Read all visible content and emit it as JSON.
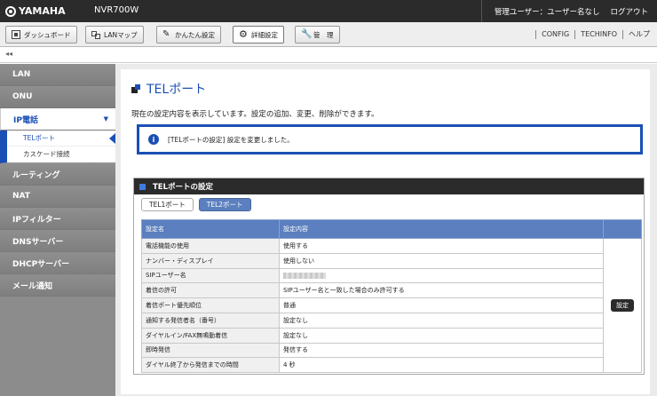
{
  "brand": {
    "logo_text": "YAMAHA",
    "model": "NVR700W"
  },
  "header": {
    "user_label": "管理ユーザー：ユーザー名なし",
    "logout": "ログアウト"
  },
  "nav": {
    "tabs": [
      {
        "label": "ダッシュボード",
        "icon": "dashboard-icon"
      },
      {
        "label": "LANマップ",
        "icon": "lan-map-icon"
      },
      {
        "label": "かんたん設定",
        "icon": "easy-setup-icon"
      },
      {
        "label": "詳細設定",
        "icon": "gear-icon",
        "active": true
      },
      {
        "label": "管　理",
        "icon": "wrench-icon"
      }
    ],
    "links": [
      "CONFIG",
      "TECHINFO",
      "ヘルプ"
    ]
  },
  "collapse_glyph": "◂◂",
  "sidebar": {
    "items": [
      {
        "label": "LAN"
      },
      {
        "label": "ONU"
      },
      {
        "label": "IP電話",
        "expanded": true,
        "chevron": "▼",
        "sub": [
          {
            "label": "TELポート",
            "active": true
          },
          {
            "label": "カスケード接続"
          }
        ]
      },
      {
        "label": "ルーティング"
      },
      {
        "label": "NAT"
      },
      {
        "label": "IPフィルター"
      },
      {
        "label": "DNSサーバー"
      },
      {
        "label": "DHCPサーバー"
      },
      {
        "label": "メール通知"
      }
    ]
  },
  "main": {
    "title": "TELポート",
    "description": "現在の設定内容を表示しています。設定の追加、変更、削除ができます。",
    "notice": "[TELポートの設定] 設定を変更しました。",
    "panel": {
      "title": "TELポートの設定",
      "subtabs": [
        {
          "label": "TEL1ポート"
        },
        {
          "label": "TEL2ポート",
          "active": true
        }
      ],
      "columns": [
        "設定名",
        "設定内容"
      ],
      "rows": [
        {
          "name": "電話機能の使用",
          "value": "使用する"
        },
        {
          "name": "ナンバー・ディスプレイ",
          "value": "使用しない"
        },
        {
          "name": "SIPユーザー名",
          "value": ""
        },
        {
          "name": "着信の許可",
          "value": "SIPユーザー名と一致した場合のみ許可する"
        },
        {
          "name": "着信ポート優先順位",
          "value": "普通"
        },
        {
          "name": "通知する発信者名（番号）",
          "value": "設定なし"
        },
        {
          "name": "ダイヤルイン/FAX無鳴動着信",
          "value": "設定なし"
        },
        {
          "name": "即時発信",
          "value": "発信する"
        },
        {
          "name": "ダイヤル終了から発信までの時間",
          "value": "4 秒"
        }
      ],
      "action_button": "設定"
    }
  },
  "colors": {
    "accent": "#1a4fb5",
    "header_bg": "#2b2b2b",
    "table_header": "#5b7fbf",
    "sidebar_bg": "#8c8c8c"
  }
}
